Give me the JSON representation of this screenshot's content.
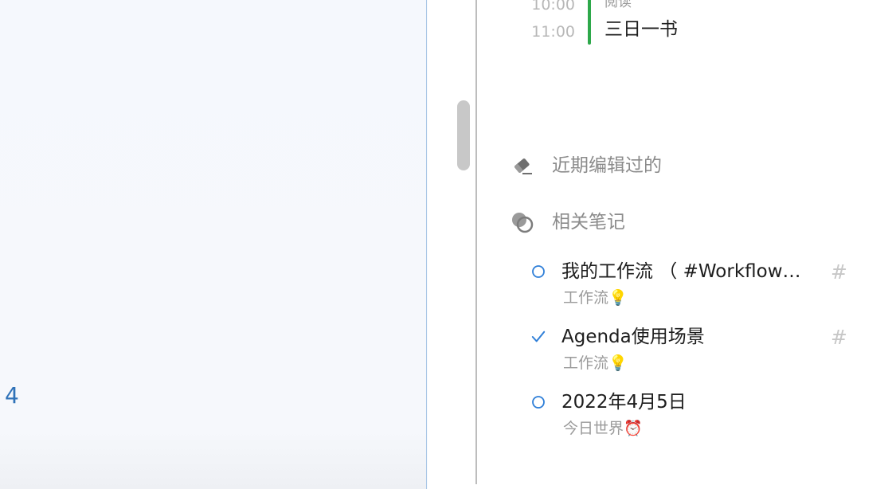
{
  "left_pane": {
    "number_text": "4"
  },
  "schedule": {
    "times": [
      "10:00",
      "11:00"
    ],
    "event_small_label": "阅读",
    "event_title": "三日一书",
    "event_color": "#2da84a"
  },
  "sections": {
    "recent": {
      "label": "近期编辑过的",
      "icon": "pencil-eraser-icon"
    },
    "related": {
      "label": "相关笔记",
      "icon": "overlapping-circles-icon"
    }
  },
  "related_notes": [
    {
      "status": "open-circle-icon",
      "title": "我的工作流 （ #Workflow…",
      "tag": "工作流",
      "tag_emoji": "💡",
      "hash": "#"
    },
    {
      "status": "checkmark-icon",
      "title": "Agenda使用场景",
      "tag": "工作流",
      "tag_emoji": "💡",
      "hash": "#"
    },
    {
      "status": "open-circle-icon",
      "title": "2022年4月5日",
      "tag": "今日世界",
      "tag_emoji": "⏰",
      "hash": ""
    }
  ],
  "colors": {
    "accent_blue": "#2f7fd8",
    "left_number": "#2f72b8",
    "section_label": "#8b8b8b"
  }
}
